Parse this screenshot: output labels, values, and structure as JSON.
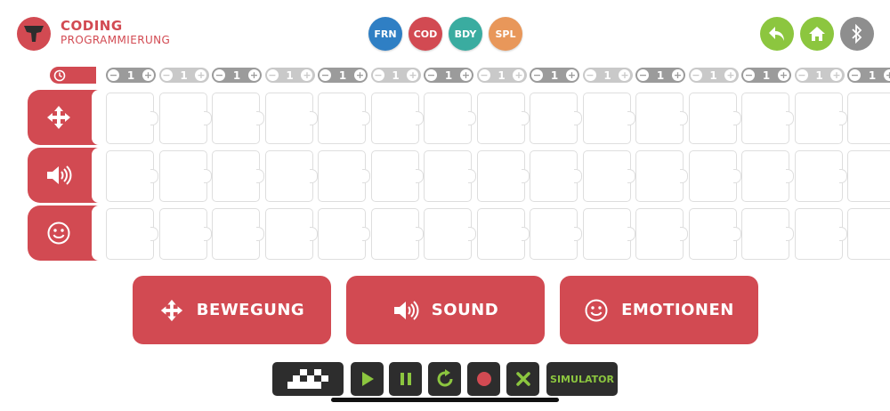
{
  "header": {
    "title": "CODING",
    "subtitle": "PROGRAMMIERUNG",
    "modes": [
      {
        "label": "FRN",
        "color": "#2f7fc4"
      },
      {
        "label": "COD",
        "color": "#d24a52"
      },
      {
        "label": "BDY",
        "color": "#3aaca0"
      },
      {
        "label": "SPL",
        "color": "#e8975a"
      }
    ],
    "actions": [
      {
        "name": "back-icon",
        "color": "#8cc63f"
      },
      {
        "name": "home-icon",
        "color": "#8cc63f"
      },
      {
        "name": "bluetooth-icon",
        "color": "#8e8e8e"
      }
    ]
  },
  "counters": {
    "minus": "−",
    "plus": "+",
    "values": [
      "1",
      "1",
      "1",
      "1",
      "1",
      "1",
      "1",
      "1",
      "1",
      "1",
      "1",
      "1",
      "1",
      "1",
      "1"
    ]
  },
  "tracks": [
    {
      "icon": "move-arrows-icon"
    },
    {
      "icon": "speaker-icon"
    },
    {
      "icon": "smiley-icon"
    }
  ],
  "categories": [
    {
      "label": "BEWEGUNG",
      "icon": "move-arrows-icon"
    },
    {
      "label": "SOUND",
      "icon": "speaker-icon"
    },
    {
      "label": "EMOTIONEN",
      "icon": "smiley-icon"
    }
  ],
  "controls": {
    "simulator_label": "SIMULATOR"
  },
  "colors": {
    "accent": "#d24a52",
    "green": "#8cc63f",
    "dark": "#2d2d2d"
  }
}
